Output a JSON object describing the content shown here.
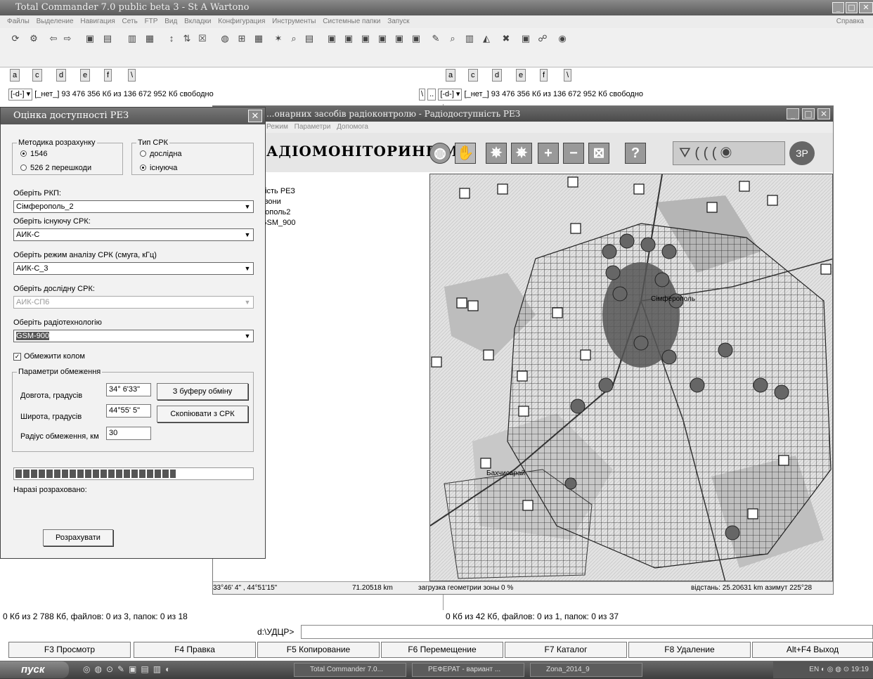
{
  "tc": {
    "title": "Total Commander 7.0 public beta 3 - St A Wartono",
    "menu": [
      "Файлы",
      "Выделение",
      "Навигация",
      "Сеть",
      "FTP",
      "Вид",
      "Вкладки",
      "Конфигурация",
      "Инструменты",
      "Системные папки",
      "Запуск"
    ],
    "help": "Справка",
    "drives": [
      "a",
      "c",
      "d",
      "e",
      "f",
      "\\"
    ],
    "path_left": "[_нет_]  93 476 356 Кб из 136 672 952 Кб свободно",
    "path_right": "[_нет_]  93 476 356 Кб из 136 672 952 Кб свободно",
    "drive_combo": "[-d-]",
    "left_status": "0 Кб из 2 788 Кб, файлов: 0 из 3, папок: 0 из 18",
    "right_status": "0 Кб из 42 Кб, файлов: 0 из 1, папок: 0 из 37",
    "cmd_prompt": "d:\\УДЦР>",
    "fkeys": [
      "F3 Просмотр",
      "F4 Правка",
      "F5 Копирование",
      "F6 Перемещение",
      "F7 Каталог",
      "F8 Удаление",
      "Alt+F4 Выход"
    ]
  },
  "mapwin": {
    "title": "...онарних засобів радіоконтролю - Радіодоступність РЕЗ",
    "menu": [
      "Режим",
      "Параметри",
      "Допомога"
    ],
    "brand": "АДІОМОНІТОРИНГ-М",
    "tree": [
      "ність РЕЗ",
      "і зони",
      "рополь2",
      "GSM_900"
    ],
    "status_coords": "33°46' 4\" , 44°51'15\"",
    "status_km": "71.20518 km",
    "status_load": "загрузка геометрии зоны 0  %",
    "status_dist": "відстань: 25.20631 km  азимут 225°28"
  },
  "dialog": {
    "title": "Оцінка доступності РЕЗ",
    "method_legend": "Методика розрахунку",
    "method_options": [
      "1546",
      "526 2 перешкоди"
    ],
    "type_legend": "Тип СРК",
    "type_options": [
      "дослідна",
      "існуюча"
    ],
    "rkp_label": "Оберіть РКП:",
    "rkp_value": "Сімферополь_2",
    "srk_label": "Оберіть існуючу СРК:",
    "srk_value": "АИК-С",
    "mode_label": "Оберіть режим аналізу СРК (смуга, кГц)",
    "mode_value": "АИК-С_3",
    "test_label": "Оберіть дослідну СРК:",
    "test_value": "АИК-СП6",
    "tech_label": "Оберіть радіотехнологію",
    "tech_value": "GSM-900",
    "limit_check": "Обмежити колом",
    "params_legend": "Параметри обмеження",
    "lon_label": "Довгота, градусів",
    "lon_value": "34° 6'33\"",
    "lat_label": "Широта, градусів",
    "lat_value": "44°55' 5\"",
    "radius_label": "Радіус обмеження, км",
    "radius_value": "30",
    "btn_clipboard": "З буферу обміну",
    "btn_copy": "Скопіювати з СРК",
    "calc_label": "Наразі розраховано:",
    "progress": 0.68,
    "btn_calc": "Розрахувати"
  },
  "map_labels": [
    "Сімферополь",
    "Бахчисарай"
  ],
  "taskbar": {
    "start": "пуск",
    "tasks": [
      "Total Commander 7.0...",
      "РЕФЕРАТ - вариант ...",
      "Zona_2014_9"
    ],
    "tray": "EN",
    "clock": "19:19"
  }
}
